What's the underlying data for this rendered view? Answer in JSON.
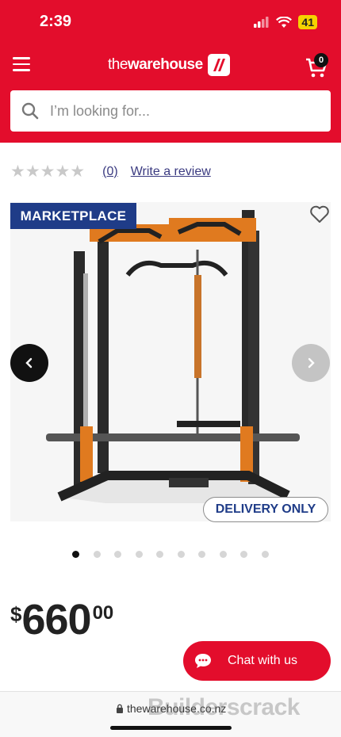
{
  "status": {
    "time": "2:39",
    "battery": "41"
  },
  "header": {
    "logo_prefix": "the",
    "logo_main": "warehouse",
    "cart_count": "0",
    "search_placeholder": "I’m looking for..."
  },
  "rating": {
    "stars": "★★★★★",
    "count": "(0)",
    "write_review": "Write a review"
  },
  "product": {
    "badge": "MARKETPLACE",
    "delivery_badge": "DELIVERY ONLY",
    "image_count": 10,
    "active_image": 0
  },
  "price": {
    "currency": "$",
    "dollars": "660",
    "cents": "00"
  },
  "chat": {
    "label": "Chat with us"
  },
  "browser": {
    "url": "thewarehouse.co.nz"
  },
  "watermark": "Builderscrack",
  "colors": {
    "brand_red": "#e30d2c",
    "marketplace_blue": "#1f3c88",
    "frame_orange": "#e07a1f"
  }
}
